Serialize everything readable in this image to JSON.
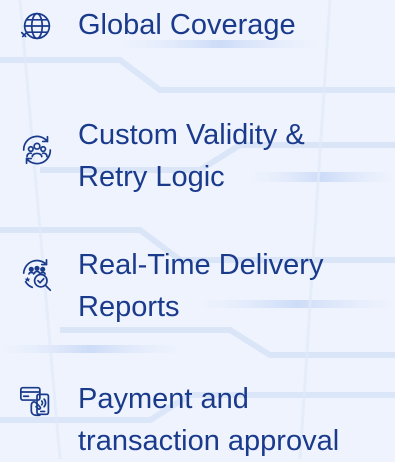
{
  "colors": {
    "text": "#1a3a8c",
    "icon": "#1a3a8c",
    "background": "#eef3fd",
    "accent_line": "#c8d7f5"
  },
  "features": [
    {
      "icon": "globe-icon",
      "lines": [
        "Global Coverage"
      ]
    },
    {
      "icon": "user-group-retry-icon",
      "lines": [
        "Custom Validity &",
        "Retry Logic"
      ]
    },
    {
      "icon": "realtime-report-icon",
      "lines": [
        "Real-Time Delivery",
        "Reports"
      ]
    },
    {
      "icon": "payment-approval-icon",
      "lines": [
        "Payment and",
        "transaction approval"
      ]
    }
  ]
}
